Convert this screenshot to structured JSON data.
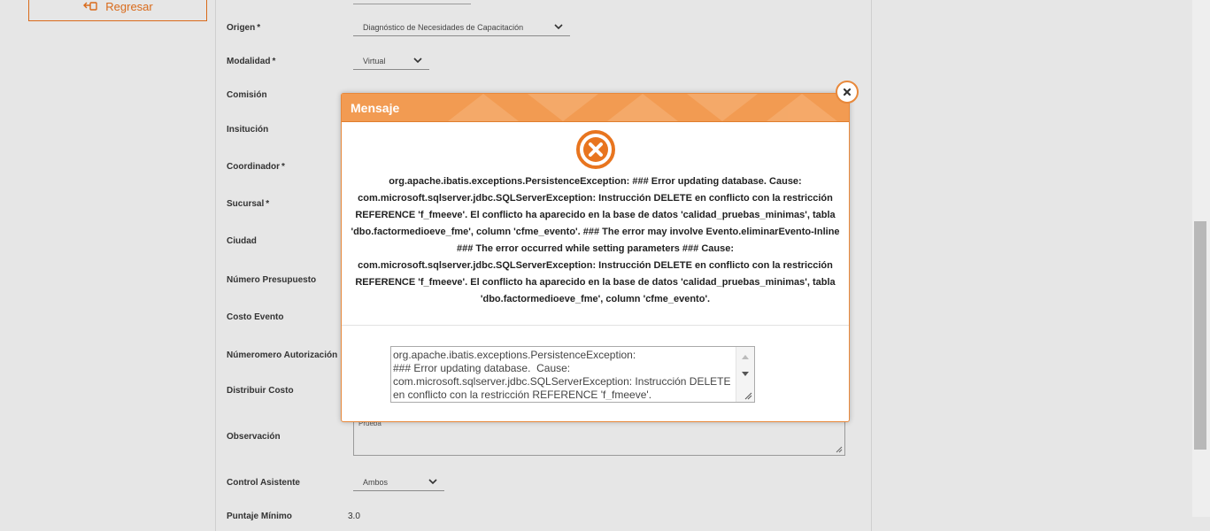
{
  "sidebar": {
    "back_label": "Regresar"
  },
  "form": {
    "fields": [
      {
        "label": "Origen",
        "required": "*",
        "value": "Diagnóstico de Necesidades de Capacitación"
      },
      {
        "label": "Modalidad",
        "required": "*",
        "value": "Virtual"
      },
      {
        "label": "Comisión",
        "required": ""
      },
      {
        "label": "Insitución",
        "required": ""
      },
      {
        "label": "Coordinador",
        "required": "*"
      },
      {
        "label": "Sucursal",
        "required": "*"
      },
      {
        "label": "Ciudad",
        "required": ""
      },
      {
        "label": "Número Presupuesto",
        "required": ""
      },
      {
        "label": "Costo Evento",
        "required": ""
      },
      {
        "label": "Númeromero Autorización",
        "required": ""
      },
      {
        "label": "Distribuir Costo",
        "required": ""
      },
      {
        "label": "Observación",
        "required": "",
        "value": "Prueba"
      },
      {
        "label": "Control Asistente",
        "required": "",
        "value": "Ambos"
      },
      {
        "label": "Puntaje Mínimo",
        "required": "",
        "value": "3.0"
      }
    ]
  },
  "modal": {
    "title": "Mensaje",
    "message": "org.apache.ibatis.exceptions.PersistenceException: ### Error updating database. Cause: com.microsoft.sqlserver.jdbc.SQLServerException: Instrucción DELETE en conflicto con la restricción REFERENCE 'f_fmeeve'. El conflicto ha aparecido en la base de datos 'calidad_pruebas_minimas', tabla 'dbo.factormedioeve_fme', column 'cfme_evento'. ### The error may involve Evento.eliminarEvento-Inline ### The error occurred while setting parameters ### Cause: com.microsoft.sqlserver.jdbc.SQLServerException: Instrucción DELETE en conflicto con la restricción REFERENCE 'f_fmeeve'. El conflicto ha aparecido en la base de datos 'calidad_pruebas_minimas', tabla 'dbo.factormedioeve_fme', column 'cfme_evento'.",
    "detail": "org.apache.ibatis.exceptions.PersistenceException: \n### Error updating database.  Cause: com.microsoft.sqlserver.jdbc.SQLServerException: Instrucción DELETE en conflicto con la restricción REFERENCE 'f_fmeeve'.",
    "icon": "error-x-icon"
  },
  "colors": {
    "accent": "#f29b52",
    "accent_dark": "#e8883a",
    "error": "#e8751f"
  }
}
